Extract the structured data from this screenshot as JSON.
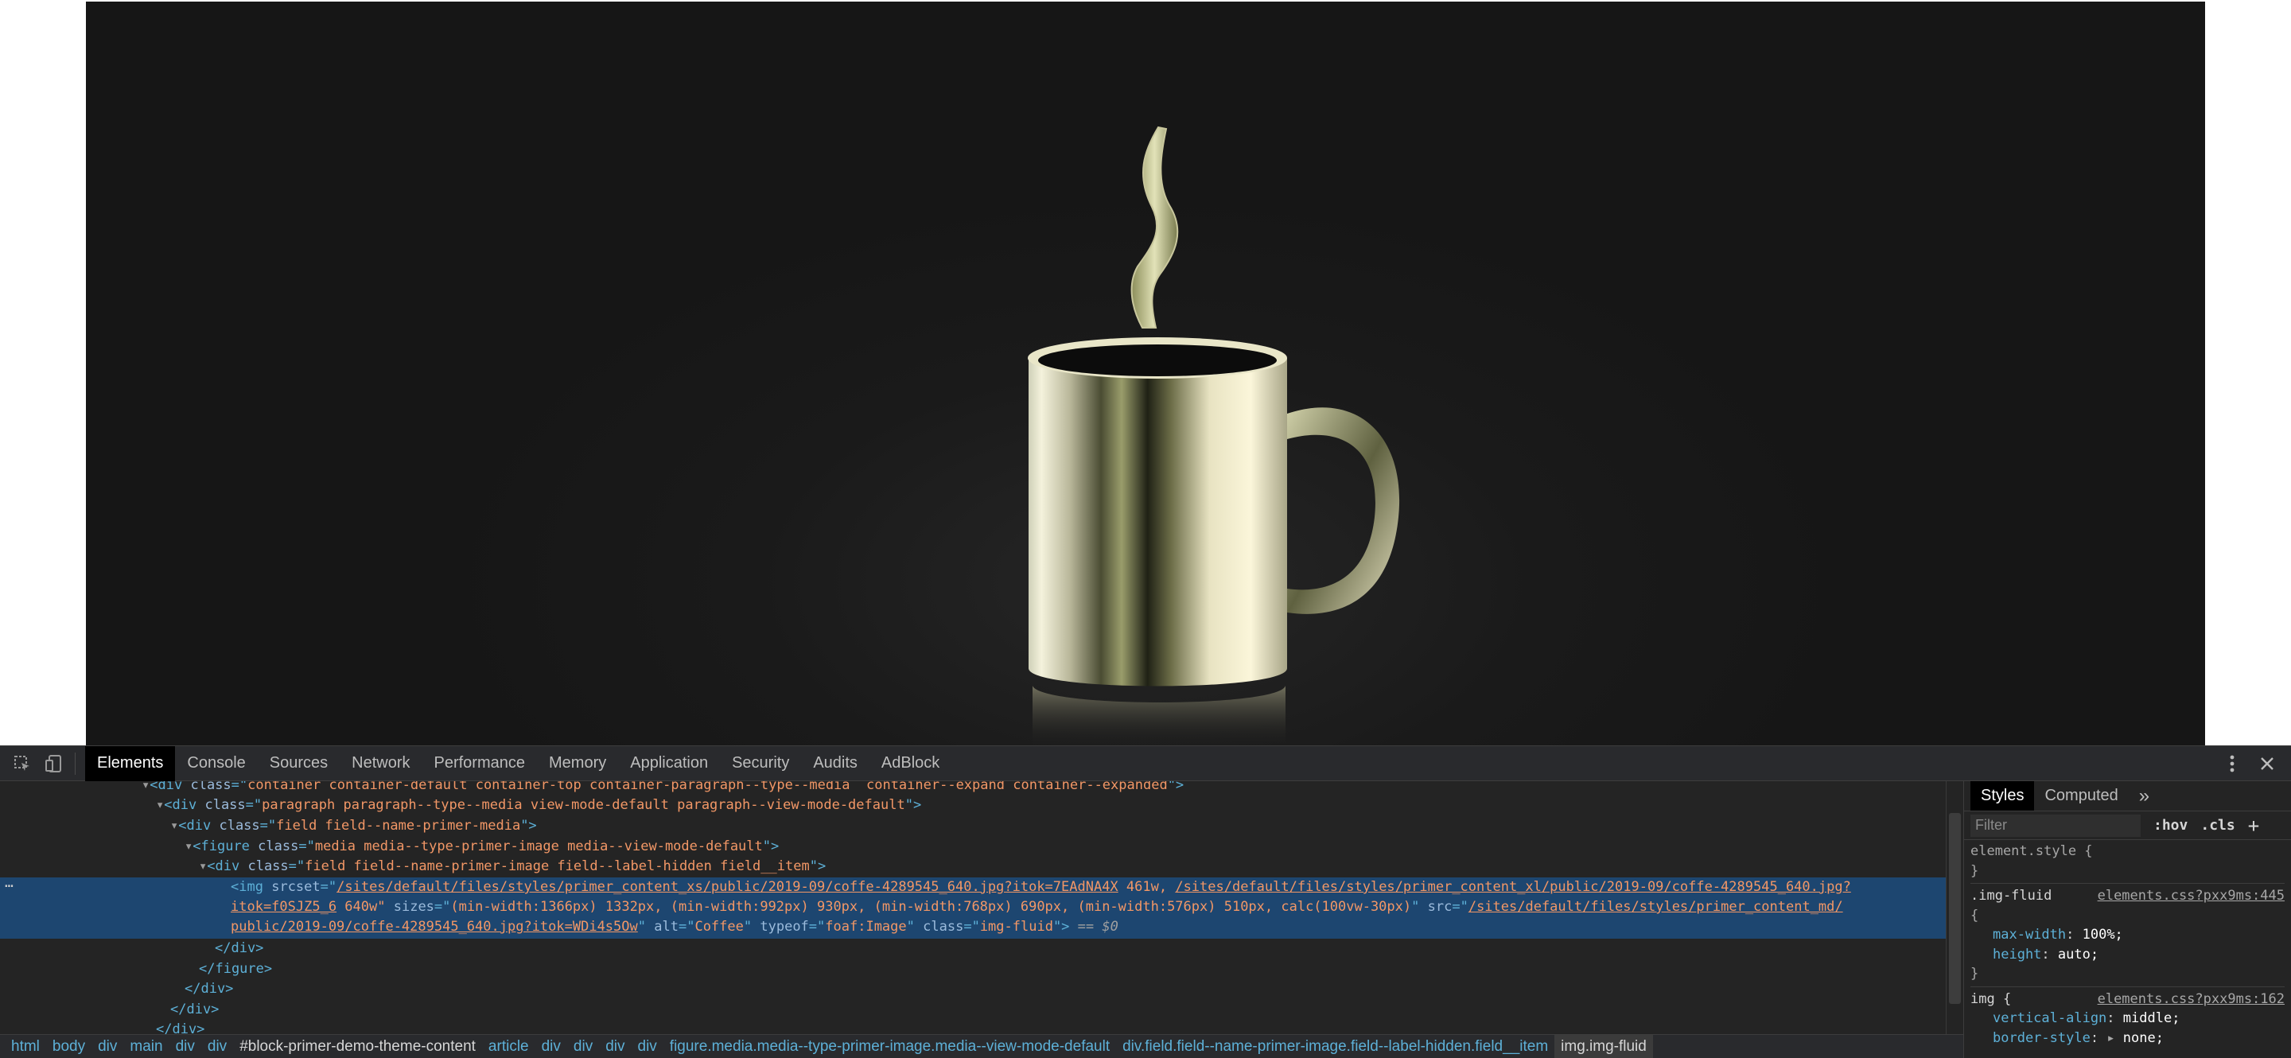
{
  "page": {
    "hero_image_alt": "Coffee"
  },
  "devtools": {
    "panel_tabs": [
      "Elements",
      "Console",
      "Sources",
      "Network",
      "Performance",
      "Memory",
      "Application",
      "Security",
      "Audits",
      "AdBlock"
    ],
    "active_tab": "Elements",
    "icons": {
      "inspect": "inspect-element-icon",
      "device": "device-toolbar-icon",
      "more": "more-vertical-icon",
      "close": "close-icon"
    },
    "tree": {
      "line0": {
        "tag": "div",
        "class": "container container-default container-top container-paragraph--type--media  container--expand container--expanded"
      },
      "line1": {
        "tag": "div",
        "class": "paragraph paragraph--type--media view-mode-default paragraph--view-mode-default"
      },
      "line2": {
        "tag": "div",
        "class": "field field--name-primer-media"
      },
      "line3": {
        "tag": "figure",
        "class": "media media--type-primer-image media--view-mode-default"
      },
      "line4": {
        "tag": "div",
        "class": "field field--name-primer-image field--label-hidden field__item"
      },
      "img": {
        "tag": "img",
        "srcset_1": "/sites/default/files/styles/primer_content_xs/public/2019-09/coffe-4289545_640.jpg?itok=7EAdNA4X",
        "w1": " 461w, ",
        "srcset_2": "/sites/default/files/styles/primer_content_xl/public/2019-09/coffe-4289545_640.jpg?",
        "srcset_2b": "itok=f0SJZ5_6",
        "w2": " 640w\"",
        "sizes": "(min-width:1366px) 1332px, (min-width:992px) 930px, (min-width:768px) 690px, (min-width:576px) 510px, calc(100vw-30px)",
        "src_1": "/sites/default/files/styles/primer_content_md/",
        "src_2": "public/2019-09/coffe-4289545_640.jpg?itok=WDi4s5Ow",
        "alt": "Coffee",
        "typeof": "foaf:Image",
        "class": "img-fluid",
        "console_ref": " == $0"
      },
      "close_div": "</div>",
      "close_figure": "</figure>",
      "close_div2": "</div>",
      "close_div3": "</div>",
      "close_div4": "</div>"
    },
    "breadcrumbs": [
      "html",
      "body",
      "div",
      "main",
      "div",
      "div",
      "#block-primer-demo-theme-content",
      "article",
      "div",
      "div",
      "div",
      "div",
      "figure.media.media--type-primer-image.media--view-mode-default",
      "div.field.field--name-primer-image.field--label-hidden.field__item",
      "img.img-fluid"
    ],
    "styles_pane": {
      "tabs": [
        "Styles",
        "Computed"
      ],
      "more_tabs": "»",
      "filter_placeholder": "Filter",
      "hov": ":hov",
      "cls": ".cls",
      "add": "+",
      "rules": {
        "r0": {
          "selector": "element.style {",
          "close": "}"
        },
        "r1": {
          "selector": ".img-fluid",
          "source": "elements.css?pxx9ms:445",
          "open": "{",
          "p1n": "max-width",
          "p1v": "100%;",
          "p2n": "height",
          "p2v": "auto;",
          "close": "}"
        },
        "r2": {
          "selector": "img {",
          "source": "elements.css?pxx9ms:162",
          "p1n": "vertical-align",
          "p1v": "middle;",
          "p2n": "border-style",
          "p2v": "none;"
        }
      }
    }
  }
}
